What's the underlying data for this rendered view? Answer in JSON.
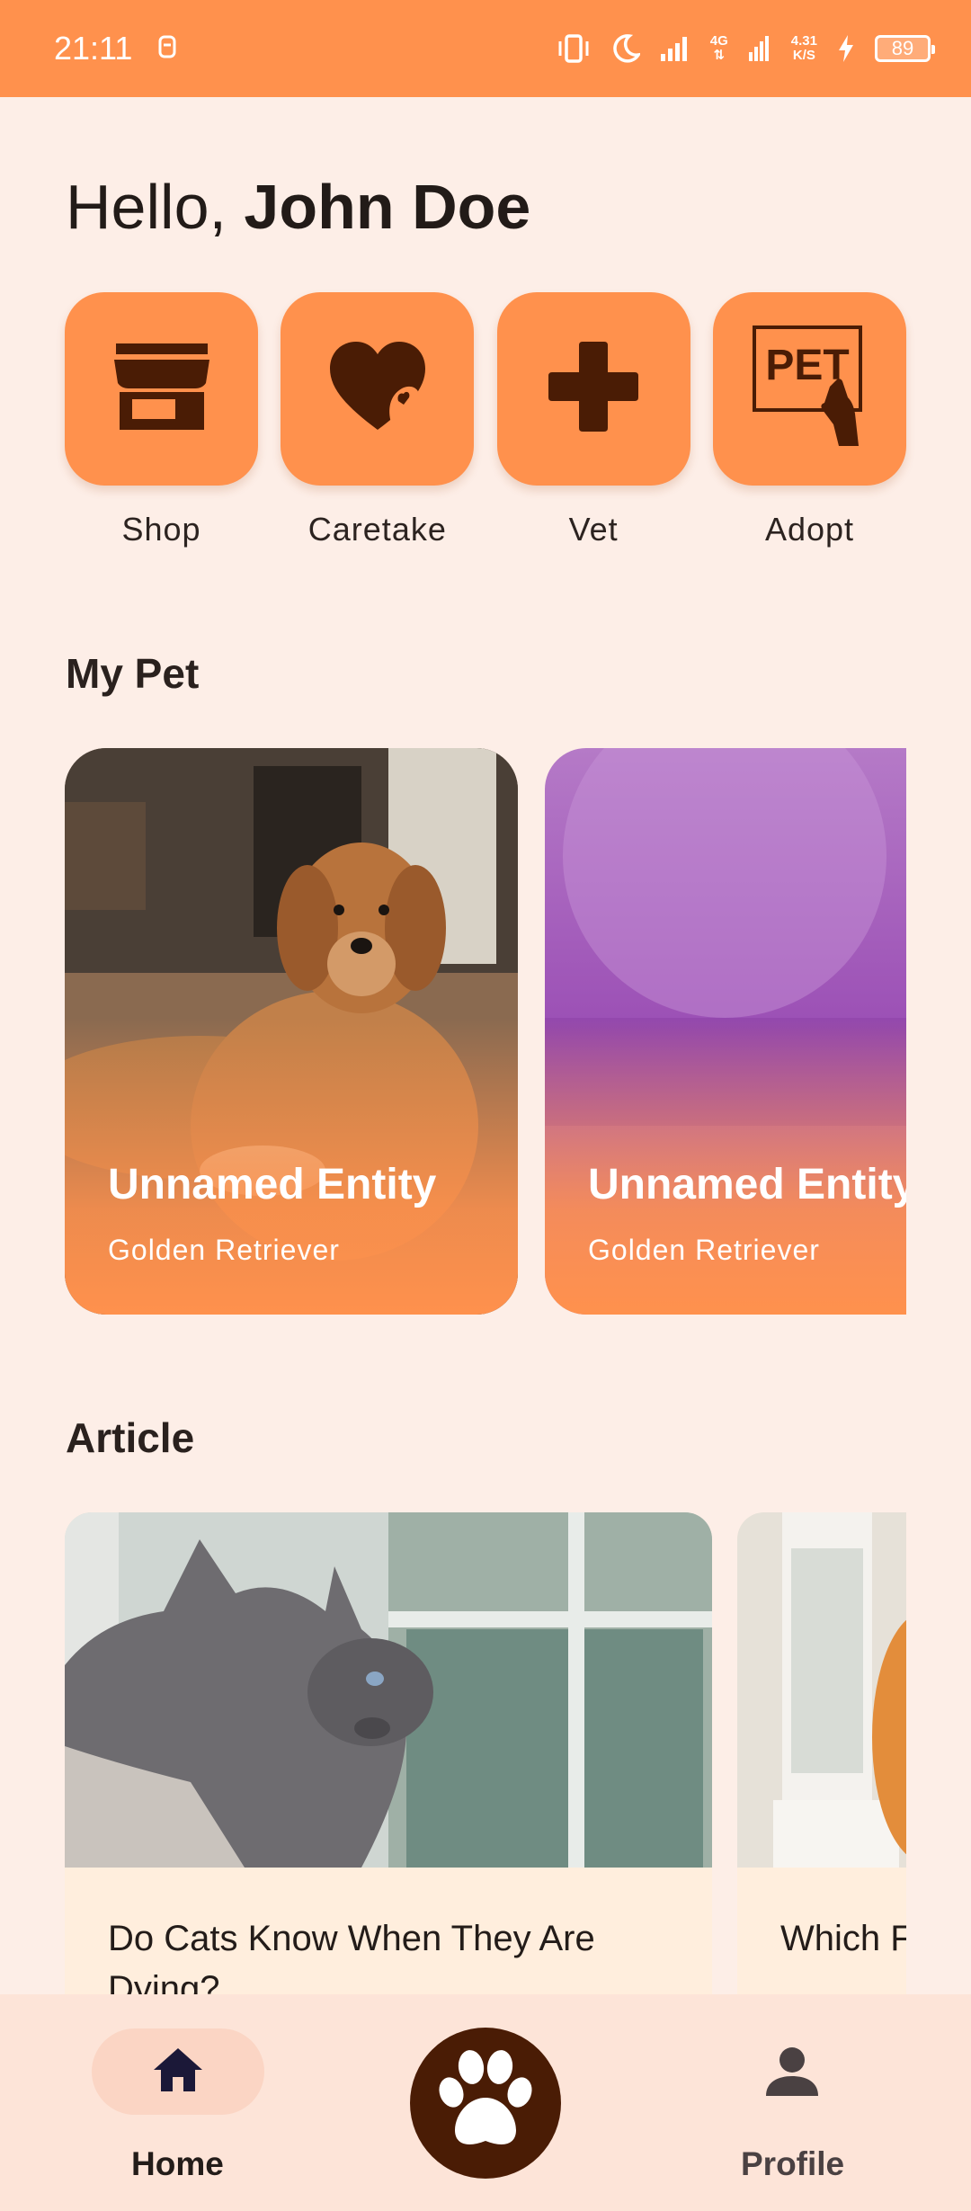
{
  "status_bar": {
    "time": "21:11",
    "net_top": "4G",
    "net_bottom": "",
    "speed_top": "4.31",
    "speed_bottom": "K/S",
    "battery": "89"
  },
  "greeting": {
    "prefix": "Hello, ",
    "name": "John Doe"
  },
  "categories": [
    {
      "label": "Shop",
      "icon": "storefront-icon"
    },
    {
      "label": "Caretake",
      "icon": "heart-hand-icon"
    },
    {
      "label": "Vet",
      "icon": "medical-cross-icon"
    },
    {
      "label": "Adopt",
      "icon": "pet-sign-icon",
      "sign_text": "PET"
    }
  ],
  "my_pet": {
    "title": "My Pet",
    "pets": [
      {
        "name": "Unnamed Entity",
        "breed": "Golden Retriever"
      },
      {
        "name": "Unnamed Entity",
        "breed": "Golden Retriever"
      }
    ]
  },
  "article": {
    "title": "Article",
    "items": [
      {
        "title": "Do Cats Know When They Are Dying?"
      },
      {
        "title": "Which F Safe fo"
      }
    ]
  },
  "bottom_nav": {
    "home_label": "Home",
    "profile_label": "Profile"
  },
  "colors": {
    "accent": "#ff914d",
    "background": "#fdeee7",
    "icon_dark": "#4a1c05",
    "nav_bg": "#fde4d8"
  }
}
